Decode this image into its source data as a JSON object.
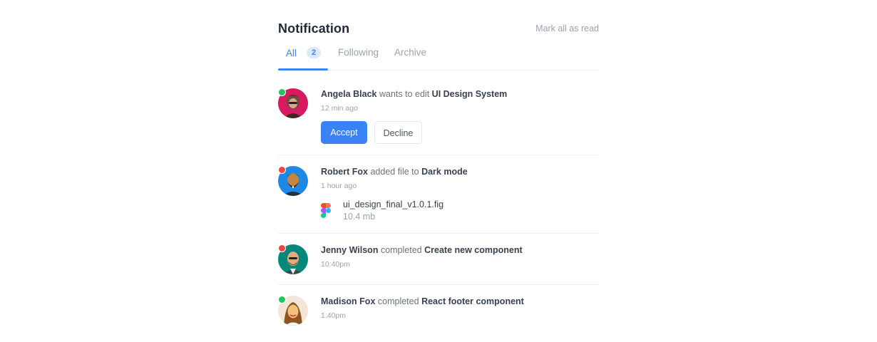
{
  "header": {
    "title": "Notification",
    "mark_all_label": "Mark all as read"
  },
  "tabs": [
    {
      "label": "All",
      "count": "2",
      "active": true
    },
    {
      "label": "Following",
      "active": false
    },
    {
      "label": "Archive",
      "active": false
    }
  ],
  "notifications": [
    {
      "user": "Angela Black",
      "action": "wants to edit",
      "target": "UI Design System",
      "time": "12 min ago",
      "status": "online",
      "accept_label": "Accept",
      "decline_label": "Decline"
    },
    {
      "user": "Robert Fox",
      "action": "added file to",
      "target": "Dark mode",
      "time": "1 hour ago",
      "status": "busy",
      "file": {
        "name": "ui_design_final_v1.0.1.fig",
        "size": "10.4 mb",
        "icon": "figma-icon"
      }
    },
    {
      "user": "Jenny Wilson",
      "action": "completed",
      "target": "Create new component",
      "time": "10:40pm",
      "status": "busy"
    },
    {
      "user": "Madison Fox",
      "action": "completed",
      "target": "React footer component",
      "time": "1:40pm",
      "status": "online"
    }
  ],
  "colors": {
    "accent": "#3b82f6",
    "online": "#22c55e",
    "busy": "#ef4444"
  }
}
